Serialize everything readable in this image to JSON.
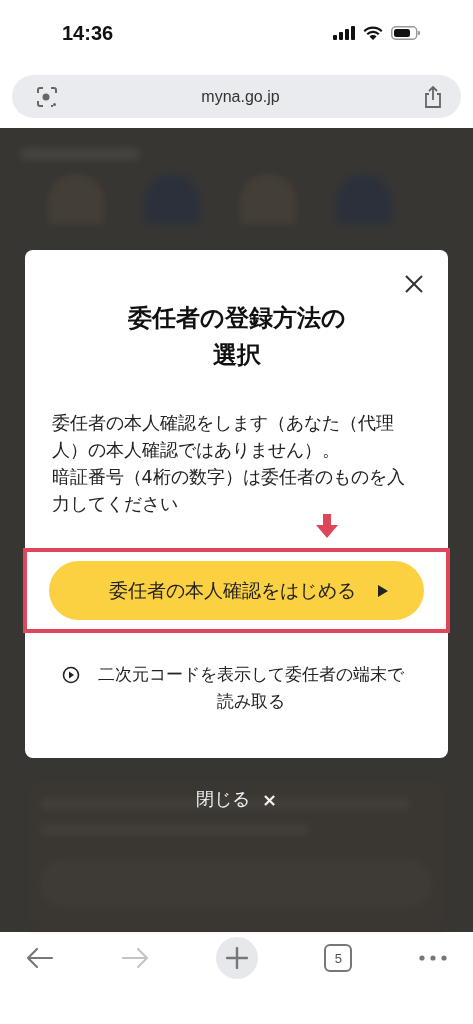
{
  "status_bar": {
    "time": "14:36"
  },
  "address_bar": {
    "url": "myna.go.jp"
  },
  "dialog": {
    "title": "委任者の登録方法の選択",
    "body": [
      "委任者の本人確認をします（あなた（代理人）の本人確認ではありません）。",
      "暗証番号（4桁の数字）は委任者のものを入力してください"
    ],
    "primary_button": {
      "label": "委任者の本人確認をはじめる",
      "highlighted": true
    },
    "secondary_link": {
      "label": "二次元コードを表示して委任者の端末で読み取る"
    }
  },
  "close_bar": {
    "label": "閉じる",
    "icon": "×"
  },
  "toolbar": [
    {
      "kind": "back",
      "disabled": false
    },
    {
      "kind": "forward",
      "disabled": true
    },
    {
      "kind": "new-tab",
      "disabled": false
    },
    {
      "kind": "tabs",
      "count": "5",
      "disabled": false
    },
    {
      "kind": "more",
      "disabled": false
    }
  ]
}
